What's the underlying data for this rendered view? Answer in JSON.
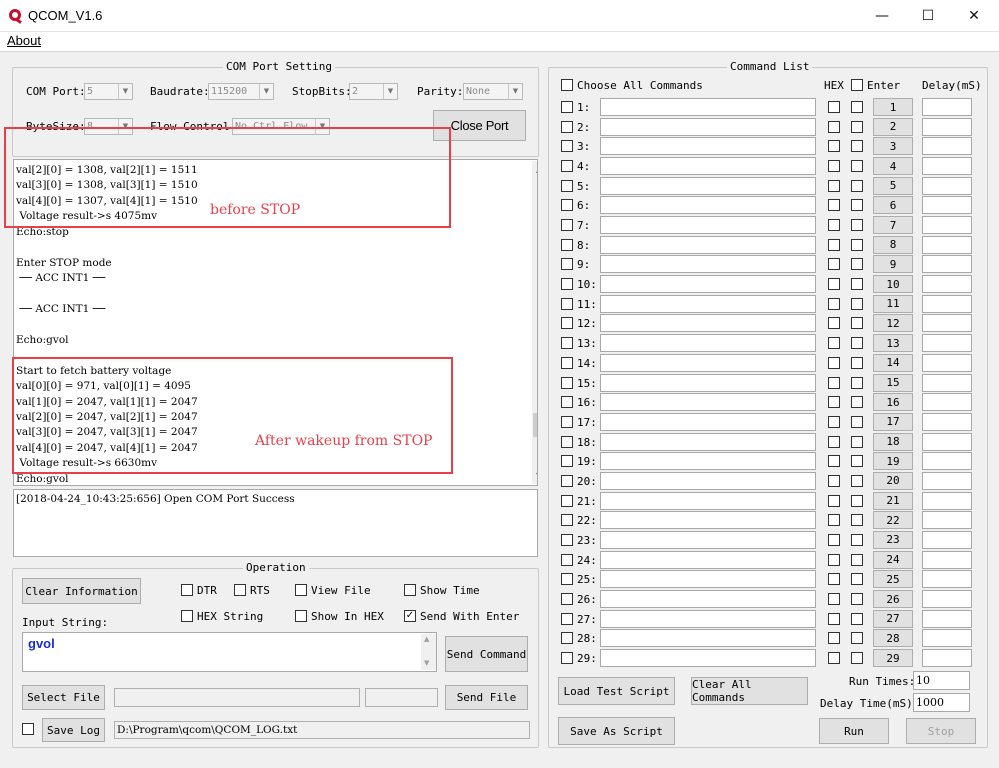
{
  "window": {
    "title": "QCOM_V1.6",
    "minimize": "—",
    "maximize": "☐",
    "close": "✕"
  },
  "menu": {
    "about": "About"
  },
  "com_setting": {
    "title": "COM Port Setting",
    "com_port_label": "COM Port:",
    "com_port_value": "5",
    "baudrate_label": "Baudrate:",
    "baudrate_value": "115200",
    "stopbits_label": "StopBits:",
    "stopbits_value": "2",
    "parity_label": "Parity:",
    "parity_value": "None",
    "bytesize_label": "ByteSize:",
    "bytesize_value": "8",
    "flow_label": "Flow Control:",
    "flow_value": "No Ctrl Flow",
    "close_port": "Close Port"
  },
  "receive": {
    "lines": [
      "val[2][0] = 1308, val[2][1] = 1511",
      "val[3][0] = 1308, val[3][1] = 1510",
      "val[4][0] = 1307, val[4][1] = 1510",
      " Voltage result->s 4075mv",
      "Echo:stop",
      "",
      "Enter STOP mode",
      " ── ACC INT1 ──",
      "",
      " ── ACC INT1 ──",
      "",
      "Echo:gvol",
      "",
      "Start to fetch battery voltage",
      "val[0][0] = 971, val[0][1] = 4095",
      "val[1][0] = 2047, val[1][1] = 2047",
      "val[2][0] = 2047, val[2][1] = 2047",
      "val[3][0] = 2047, val[3][1] = 2047",
      "val[4][0] = 2047, val[4][1] = 2047",
      " Voltage result->s 6630mv",
      "Echo:gvol"
    ],
    "annotation_before": "before STOP",
    "annotation_after": "After wakeup from STOP"
  },
  "status_log": {
    "line": "[2018-04-24_10:43:25:656] Open COM Port Success"
  },
  "operation": {
    "title": "Operation",
    "clear_info": "Clear Information",
    "dtr": "DTR",
    "rts": "RTS",
    "view_file": "View File",
    "show_time": "Show Time",
    "hex_string": "HEX String",
    "show_in_hex": "Show In HEX",
    "send_with_enter": "Send With Enter",
    "input_label": "Input String:",
    "input_value": "gvol",
    "send_command": "Send Command",
    "select_file": "Select File",
    "send_file": "Send File",
    "save_log": "Save Log",
    "log_path": "D:\\Program\\qcom\\QCOM_LOG.txt",
    "check": "✓"
  },
  "command_list": {
    "title": "Command List",
    "choose_all": "Choose All Commands",
    "hex_header": "HEX",
    "enter_header": "Enter",
    "delay_header": "Delay(mS)",
    "rows": [
      {
        "label": "1:",
        "btn": "1"
      },
      {
        "label": "2:",
        "btn": "2"
      },
      {
        "label": "3:",
        "btn": "3"
      },
      {
        "label": "4:",
        "btn": "4"
      },
      {
        "label": "5:",
        "btn": "5"
      },
      {
        "label": "6:",
        "btn": "6"
      },
      {
        "label": "7:",
        "btn": "7"
      },
      {
        "label": "8:",
        "btn": "8"
      },
      {
        "label": "9:",
        "btn": "9"
      },
      {
        "label": "10:",
        "btn": "10"
      },
      {
        "label": "11:",
        "btn": "11"
      },
      {
        "label": "12:",
        "btn": "12"
      },
      {
        "label": "13:",
        "btn": "13"
      },
      {
        "label": "14:",
        "btn": "14"
      },
      {
        "label": "15:",
        "btn": "15"
      },
      {
        "label": "16:",
        "btn": "16"
      },
      {
        "label": "17:",
        "btn": "17"
      },
      {
        "label": "18:",
        "btn": "18"
      },
      {
        "label": "19:",
        "btn": "19"
      },
      {
        "label": "20:",
        "btn": "20"
      },
      {
        "label": "21:",
        "btn": "21"
      },
      {
        "label": "22:",
        "btn": "22"
      },
      {
        "label": "23:",
        "btn": "23"
      },
      {
        "label": "24:",
        "btn": "24"
      },
      {
        "label": "25:",
        "btn": "25"
      },
      {
        "label": "26:",
        "btn": "26"
      },
      {
        "label": "27:",
        "btn": "27"
      },
      {
        "label": "28:",
        "btn": "28"
      },
      {
        "label": "29:",
        "btn": "29"
      }
    ],
    "load_script": "Load Test Script",
    "clear_all": "Clear All Commands",
    "save_script": "Save As Script",
    "run_times_label": "Run Times:",
    "run_times_value": "10",
    "delay_time_label": "Delay Time(mS):",
    "delay_time_value": "1000",
    "run": "Run",
    "stop": "Stop"
  },
  "colors": {
    "annotation": "#e8404a",
    "input_text": "#1a2fd0"
  }
}
